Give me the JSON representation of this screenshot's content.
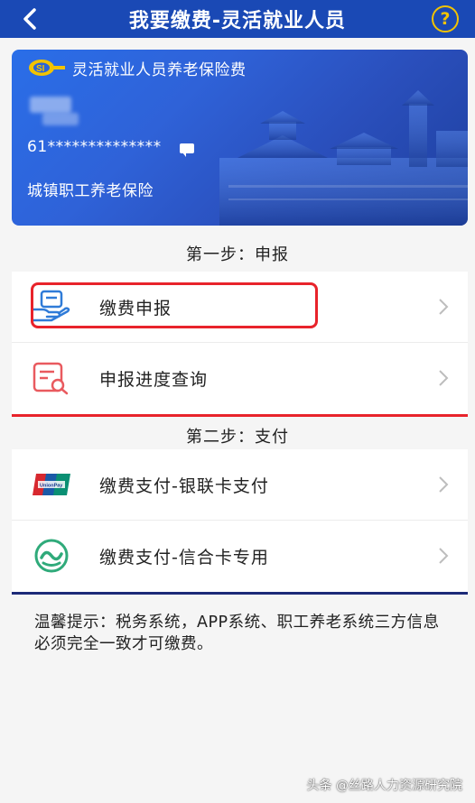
{
  "header": {
    "title": "我要缴费-灵活就业人员",
    "help_label": "?"
  },
  "card": {
    "title": "灵活就业人员养老保险费",
    "number": "61**************",
    "type": "城镇职工养老保险"
  },
  "step1": {
    "label": "第一步：申报",
    "items": [
      {
        "label": "缴费申报",
        "icon": "payment-declaration-icon"
      },
      {
        "label": "申报进度查询",
        "icon": "progress-query-icon"
      }
    ]
  },
  "step2": {
    "label": "第二步：支付",
    "items": [
      {
        "label": "缴费支付-银联卡支付",
        "icon": "unionpay-icon"
      },
      {
        "label": "缴费支付-信合卡专用",
        "icon": "xinhe-card-icon"
      }
    ]
  },
  "tip": "温馨提示：税务系统，APP系统、职工养老系统三方信息必须完全一致才可缴费。",
  "watermark": "头条 @丝路人力资源研究院",
  "colors": {
    "header": "#1a49b5",
    "accent_red": "#e8232b",
    "accent_navy": "#1c2a78",
    "help_yellow": "#f2c300"
  }
}
